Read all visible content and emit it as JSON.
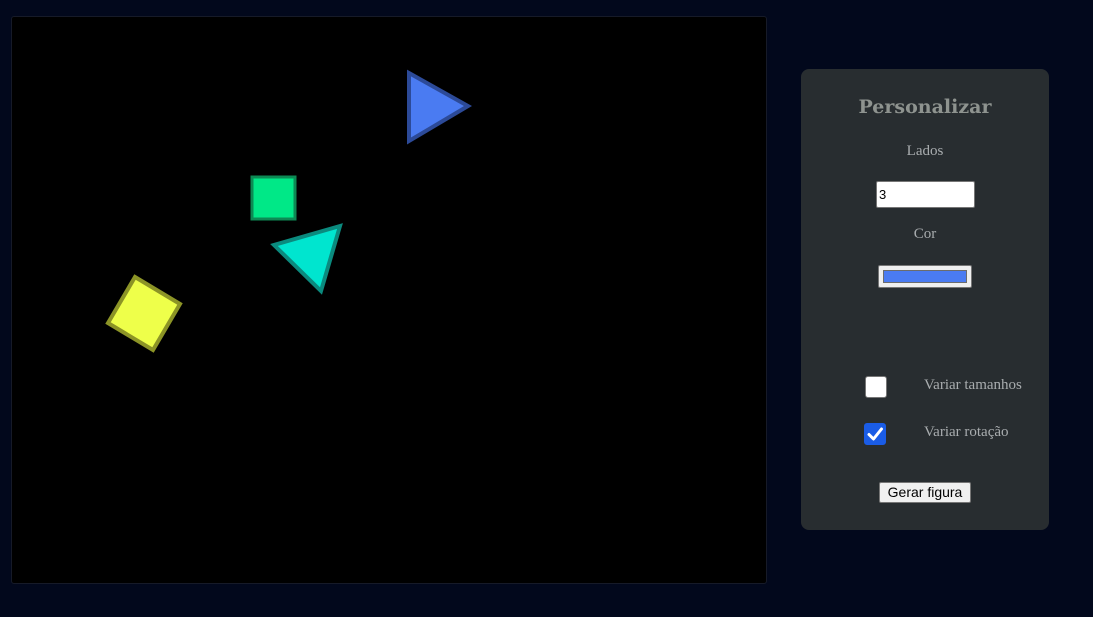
{
  "panel": {
    "title": "Personalizar",
    "sides_label": "Lados",
    "sides_value": "3",
    "color_label": "Cor",
    "color_value": "#4a7bf2",
    "vary_size_label": "Variar tamanhos",
    "vary_size_checked": false,
    "vary_rotation_label": "Variar rotação",
    "vary_rotation_checked": true,
    "generate_button": "Gerar figura"
  },
  "shapes": [
    {
      "name": "blue-triangle",
      "sides": 3,
      "fill": "#4a7bf2",
      "stroke": "#2c4a98"
    },
    {
      "name": "green-square",
      "sides": 4,
      "fill": "#00e887",
      "stroke": "#0d8a54"
    },
    {
      "name": "cyan-triangle",
      "sides": 3,
      "fill": "#00e5cf",
      "stroke": "#0b8a7e"
    },
    {
      "name": "yellow-square",
      "sides": 4,
      "fill": "#eeff4a",
      "stroke": "#8c9426"
    }
  ]
}
